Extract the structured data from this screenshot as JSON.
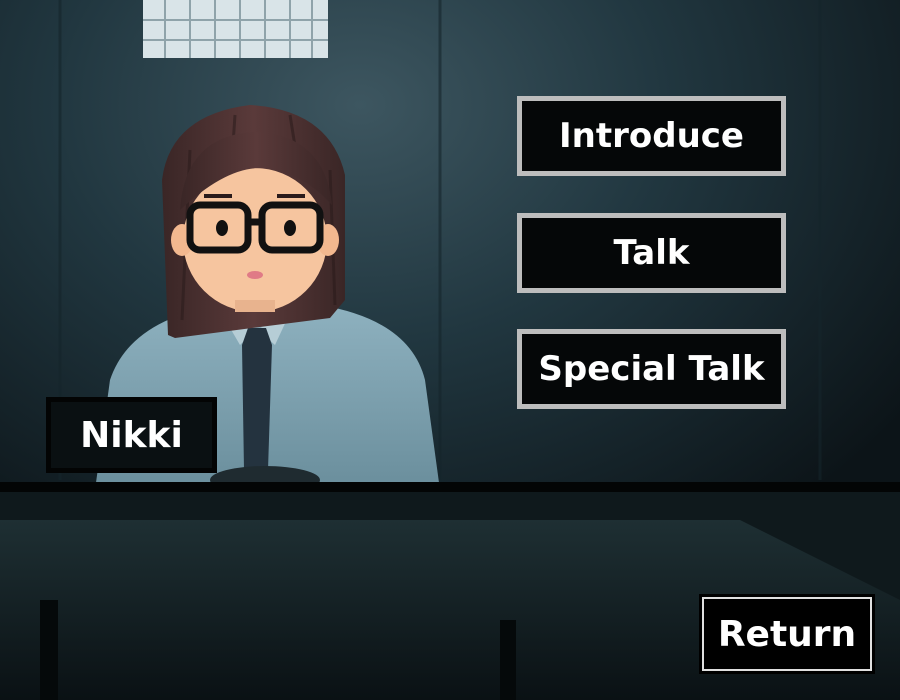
{
  "buttons": {
    "introduce": "Introduce",
    "talk": "Talk",
    "special_talk": "Special Talk"
  },
  "character": {
    "name": "Nikki"
  },
  "navigation": {
    "return_label": "Return"
  },
  "colors": {
    "button_border": "#bdbdbd",
    "button_fill": "#050708",
    "text": "#ffffff",
    "room": "#1d3038"
  }
}
